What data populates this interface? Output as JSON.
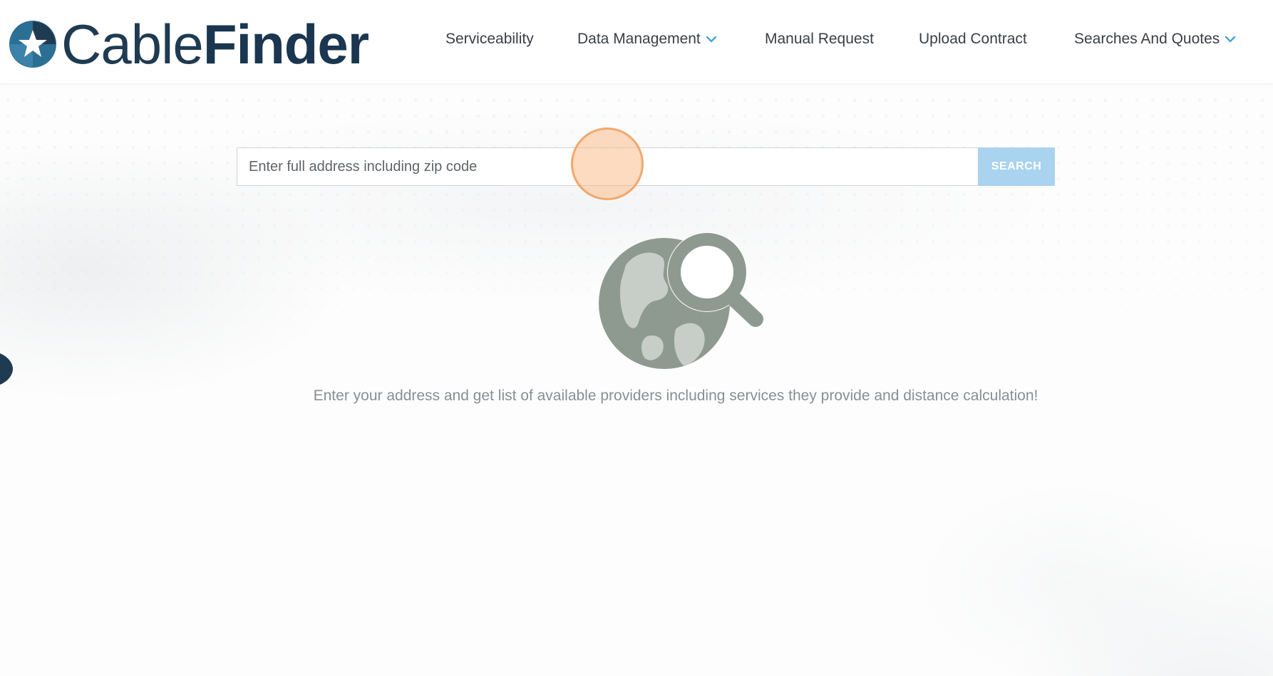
{
  "header": {
    "logo": {
      "text_light": "Cable",
      "text_bold": "Finder",
      "icon": "star-circle-logo-icon"
    },
    "nav": [
      {
        "label": "Serviceability",
        "dropdown": false
      },
      {
        "label": "Data Management",
        "dropdown": true,
        "icon": "chevron-down-icon"
      },
      {
        "label": "Manual Request",
        "dropdown": false
      },
      {
        "label": "Upload Contract",
        "dropdown": false
      },
      {
        "label": "Searches And Quotes",
        "dropdown": true,
        "icon": "chevron-down-icon"
      }
    ]
  },
  "search": {
    "value": "",
    "placeholder": "Enter full address including zip code",
    "button_label": "SEARCH"
  },
  "main": {
    "illustration_icon": "globe-search-icon",
    "hint": "Enter your address and get list of available providers including services they provide and distance calculation!"
  },
  "colors": {
    "brand_navy": "#1f3b52",
    "brand_blue": "#2c6f95",
    "search_button": "#a9d3ef",
    "chevron": "#4aa3d8",
    "illustration": "#8e9a90",
    "cursor_marker": "#f5a86a"
  }
}
